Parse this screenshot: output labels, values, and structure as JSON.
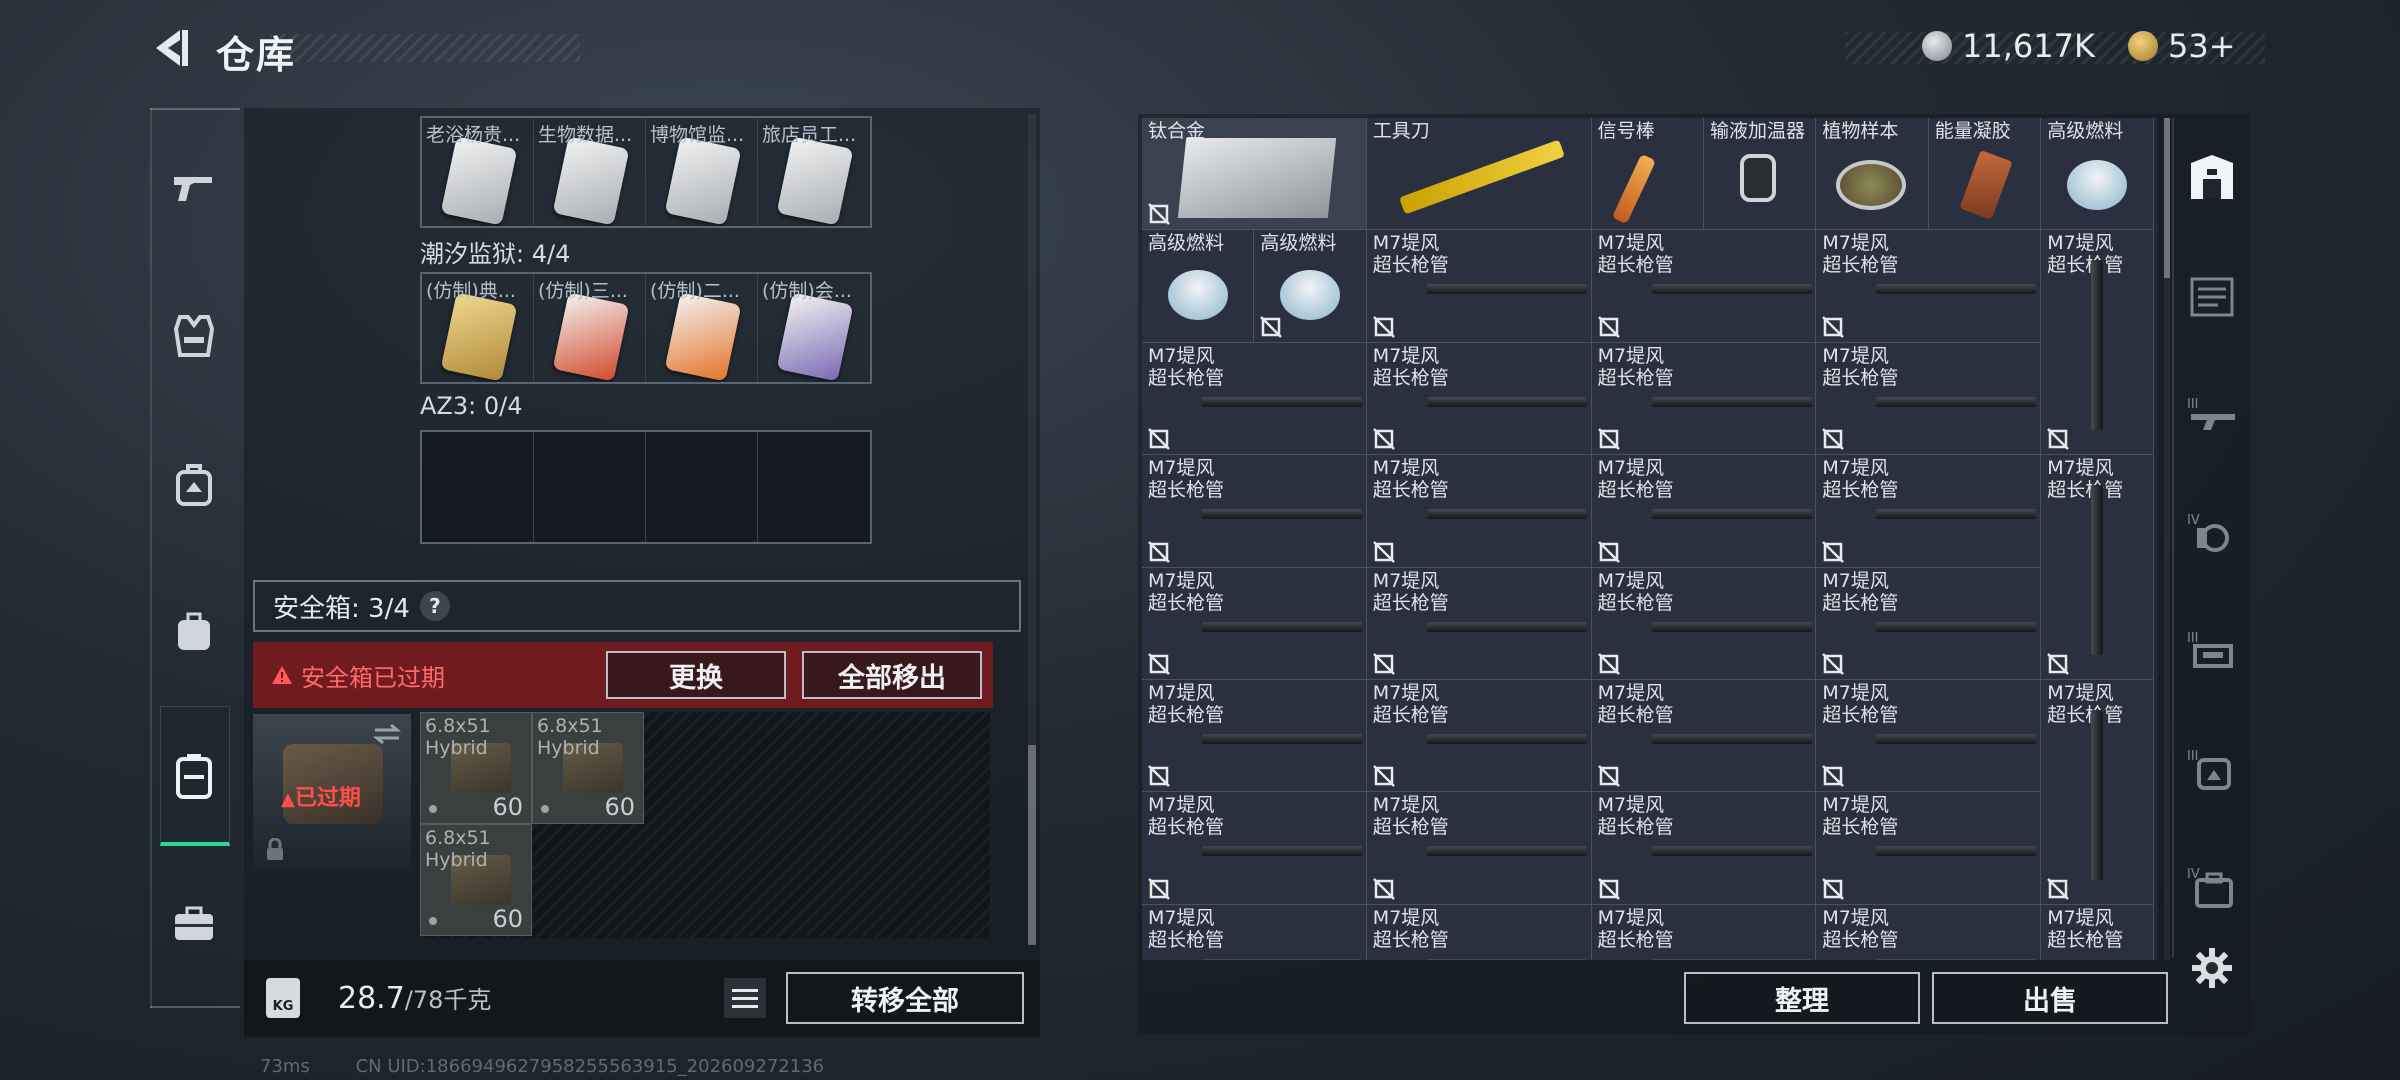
{
  "header": {
    "title": "仓库",
    "currency_a": "11,617K",
    "currency_b": "53+"
  },
  "left": {
    "row1_cards": [
      {
        "label": "老浴杨贵...",
        "color": "#7a2f33"
      },
      {
        "label": "生物数据...",
        "color": "#7a2f33"
      },
      {
        "label": "博物馆监...",
        "color": "#6a5844"
      },
      {
        "label": "旅店员工...",
        "color": "#3c4462"
      }
    ],
    "section2_label": "潮汐监狱: 4/4",
    "row2_cards": [
      {
        "label": "(仿制)典...",
        "color": "#7a2f33"
      },
      {
        "label": "(仿制)三...",
        "color": "#7a2f33"
      },
      {
        "label": "(仿制)二...",
        "color": "#6a5844"
      },
      {
        "label": "(仿制)会...",
        "color": "#3c4462"
      }
    ],
    "section3_label": "AZ3: 0/4",
    "safe_label": "安全箱: 3/4",
    "help": "?",
    "alert_text": "安全箱已过期",
    "replace_button": "更换",
    "remove_all_button": "全部移出",
    "expired_tag": "已过期",
    "ammo": [
      {
        "line1": "6.8x51",
        "line2": "Hybrid",
        "count": "60"
      },
      {
        "line1": "6.8x51",
        "line2": "Hybrid",
        "count": "60"
      },
      {
        "line1": "6.8x51",
        "line2": "Hybrid",
        "count": "60"
      }
    ],
    "weight_value": "28.7",
    "weight_max": "/78千克",
    "kg_label": "KG",
    "transfer_all_button": "转移全部"
  },
  "inventory": {
    "top_items": [
      {
        "label": "钛合金"
      },
      {
        "label": "工具刀"
      },
      {
        "label": "信号棒"
      },
      {
        "label": "输液加温器"
      },
      {
        "label": "植物样本"
      },
      {
        "label": "能量凝胶"
      },
      {
        "label": "高级燃料"
      }
    ],
    "fuel_label": "高级燃料",
    "barrel_line1": "M7堤风",
    "barrel_line2": "超长枪管",
    "sort_button": "整理",
    "sell_button": "出售"
  },
  "footer": {
    "ping": "73ms",
    "uid": "CN UID:1866949627958255563915_202609272136"
  },
  "colors": {
    "accent_green": "#2fd69a",
    "alert_red": "#ff4d4a"
  }
}
